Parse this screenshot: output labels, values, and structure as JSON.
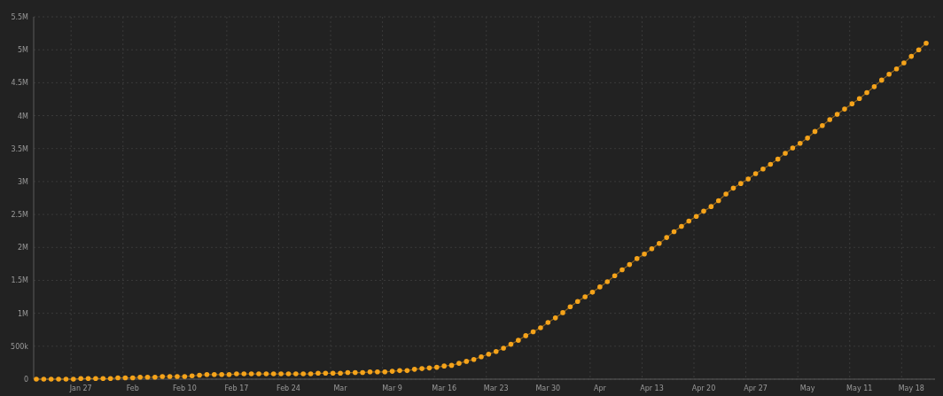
{
  "chart_data": {
    "type": "line",
    "categories": [
      null,
      null,
      null,
      null,
      null,
      null,
      "Jan 27",
      null,
      null,
      null,
      null,
      null,
      null,
      "Feb",
      null,
      null,
      null,
      null,
      null,
      null,
      "Feb 10",
      null,
      null,
      null,
      null,
      null,
      null,
      "Feb 17",
      null,
      null,
      null,
      null,
      null,
      null,
      "Feb 24",
      null,
      null,
      null,
      null,
      null,
      null,
      "Mar",
      null,
      null,
      null,
      null,
      null,
      null,
      "Mar 9",
      null,
      null,
      null,
      null,
      null,
      null,
      "Mar 16",
      null,
      null,
      null,
      null,
      null,
      null,
      "Mar 23",
      null,
      null,
      null,
      null,
      null,
      null,
      "Mar 30",
      null,
      null,
      null,
      null,
      null,
      null,
      "Apr",
      null,
      null,
      null,
      null,
      null,
      null,
      "Apr 13",
      null,
      null,
      null,
      null,
      null,
      null,
      "Apr 20",
      null,
      null,
      null,
      null,
      null,
      null,
      "Apr 27",
      null,
      null,
      null,
      null,
      null,
      null,
      "May",
      null,
      null,
      null,
      null,
      null,
      null,
      "May 11",
      null,
      null,
      null,
      null,
      null,
      null,
      "May 18",
      null,
      null
    ],
    "series": [
      {
        "color": "#f5a31a",
        "values": [
          0,
          0,
          0,
          0,
          0,
          0,
          10000,
          10000,
          10000,
          10000,
          10000,
          20000,
          20000,
          20000,
          30000,
          30000,
          30000,
          40000,
          40000,
          40000,
          40000,
          50000,
          60000,
          70000,
          70000,
          70000,
          70000,
          80000,
          80000,
          80000,
          80000,
          80000,
          80000,
          80000,
          80000,
          80000,
          80000,
          80000,
          90000,
          90000,
          90000,
          90000,
          100000,
          100000,
          100000,
          110000,
          110000,
          110000,
          120000,
          130000,
          130000,
          150000,
          160000,
          170000,
          180000,
          200000,
          210000,
          240000,
          270000,
          300000,
          340000,
          380000,
          420000,
          470000,
          530000,
          590000,
          660000,
          720000,
          780000,
          860000,
          930000,
          1010000,
          1100000,
          1180000,
          1250000,
          1320000,
          1400000,
          1480000,
          1570000,
          1660000,
          1740000,
          1830000,
          1900000,
          1980000,
          2060000,
          2150000,
          2240000,
          2320000,
          2400000,
          2470000,
          2550000,
          2620000,
          2710000,
          2810000,
          2900000,
          2970000,
          3040000,
          3120000,
          3190000,
          3260000,
          3340000,
          3430000,
          3510000,
          3580000,
          3660000,
          3760000,
          3850000,
          3940000,
          4020000,
          4100000,
          4180000,
          4260000,
          4350000,
          4440000,
          4540000,
          4630000,
          4710000,
          4800000,
          4900000,
          5000000,
          5100000
        ]
      }
    ],
    "ylim": [
      0,
      5500000
    ],
    "grid": true,
    "yticks": [
      {
        "value": 0,
        "label": "0"
      },
      {
        "value": 500000,
        "label": "500k"
      },
      {
        "value": 1000000,
        "label": "1M"
      },
      {
        "value": 1500000,
        "label": "1.5M"
      },
      {
        "value": 2000000,
        "label": "2M"
      },
      {
        "value": 2500000,
        "label": "2.5M"
      },
      {
        "value": 3000000,
        "label": "3M"
      },
      {
        "value": 3500000,
        "label": "3.5M"
      },
      {
        "value": 4000000,
        "label": "4M"
      },
      {
        "value": 4500000,
        "label": "4.5M"
      },
      {
        "value": 5000000,
        "label": "5M"
      },
      {
        "value": 5500000,
        "label": "5.5M"
      }
    ]
  }
}
